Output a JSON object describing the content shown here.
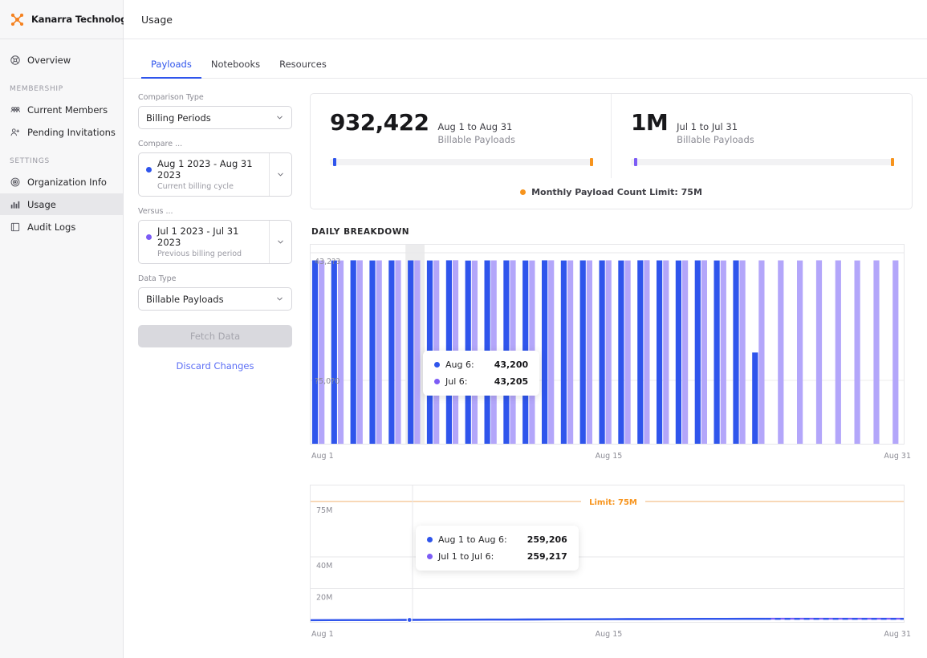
{
  "brand": {
    "name": "Kanarra Technologies",
    "logo_icon": "kanarra-node-logo-icon",
    "accent": "#F58220"
  },
  "sidebar": {
    "items": [
      {
        "label": "Overview",
        "icon": "overview-icon",
        "active": false
      }
    ],
    "groups": [
      {
        "title": "MEMBERSHIP",
        "items": [
          {
            "label": "Current Members",
            "icon": "users-icon",
            "active": false
          },
          {
            "label": "Pending Invitations",
            "icon": "user-plus-icon",
            "active": false
          }
        ]
      },
      {
        "title": "SETTINGS",
        "items": [
          {
            "label": "Organization Info",
            "icon": "gear-icon",
            "active": false
          },
          {
            "label": "Usage",
            "icon": "bar-chart-icon",
            "active": true
          },
          {
            "label": "Audit Logs",
            "icon": "book-icon",
            "active": false
          }
        ]
      }
    ]
  },
  "header": {
    "title": "Usage"
  },
  "tabs": [
    {
      "label": "Payloads",
      "active": true
    },
    {
      "label": "Notebooks",
      "active": false
    },
    {
      "label": "Resources",
      "active": false
    }
  ],
  "form": {
    "comparison_type": {
      "label": "Comparison Type",
      "value": "Billing Periods"
    },
    "compare": {
      "label": "Compare ...",
      "value": "Aug 1 2023 - Aug 31 2023",
      "sub": "Current billing cycle",
      "dot_color": "#2f55ec"
    },
    "versus": {
      "label": "Versus ...",
      "value": "Jul 1 2023 - Jul 31 2023",
      "sub": "Previous billing period",
      "dot_color": "#7c5cf5"
    },
    "data_type": {
      "label": "Data Type",
      "value": "Billable Payloads"
    },
    "fetch_button": "Fetch Data",
    "discard_button": "Discard Changes"
  },
  "summary": {
    "current": {
      "value": "932,422",
      "range": "Aug 1 to Aug 31",
      "type": "Billable Payloads",
      "marker_color": "#2f55ec",
      "marker_pct": 1.2,
      "limit_marker_pct": 99.3,
      "limit_color": "#F7941D"
    },
    "previous": {
      "value": "1M",
      "range": "Jul 1 to Jul 31",
      "type": "Billable Payloads",
      "marker_color": "#7c5cf5",
      "marker_pct": 1.2,
      "limit_marker_pct": 99.3,
      "limit_color": "#F7941D"
    },
    "legend": {
      "label": "Monthly Payload Count Limit: 75M",
      "color": "#F7941D"
    }
  },
  "daily_section_title": "DAILY BREAKDOWN",
  "daily_tooltip": {
    "rows": [
      {
        "label": "Aug 6:",
        "value": "43,200",
        "color": "#2f55ec"
      },
      {
        "label": "Jul 6:",
        "value": "43,205",
        "color": "#7c5cf5"
      }
    ]
  },
  "cumulative_tooltip": {
    "rows": [
      {
        "label": "Aug 1 to Aug 6:",
        "value": "259,206",
        "color": "#2f55ec"
      },
      {
        "label": "Jul 1 to Jul 6:",
        "value": "259,217",
        "color": "#7c5cf5"
      }
    ]
  },
  "limit_line": {
    "label": "Limit: 75M",
    "color": "#F7941D"
  },
  "chart_data": [
    {
      "type": "bar",
      "id": "daily-breakdown",
      "title": "DAILY BREAKDOWN",
      "xlabel": "",
      "ylabel": "",
      "grid": true,
      "legend_position": "none",
      "x_ticks": [
        "Aug 1",
        "Aug 15",
        "Aug 31"
      ],
      "y_ticks": [
        "43,2?3",
        "?5,0?0"
      ],
      "ylim": [
        0,
        45000
      ],
      "categories": [
        "1",
        "2",
        "3",
        "4",
        "5",
        "6",
        "7",
        "8",
        "9",
        "10",
        "11",
        "12",
        "13",
        "14",
        "15",
        "16",
        "17",
        "18",
        "19",
        "20",
        "21",
        "22",
        "23",
        "24",
        "25",
        "26",
        "27",
        "28",
        "29",
        "30",
        "31"
      ],
      "series": [
        {
          "name": "Aug 1 2023 - Aug 31 2023",
          "color": "#2f55ec",
          "values": [
            43200,
            43180,
            43220,
            43190,
            43210,
            43200,
            43190,
            43230,
            43170,
            43200,
            43210,
            43180,
            43220,
            43190,
            43200,
            43210,
            43180,
            43230,
            43200,
            43190,
            43210,
            43180,
            43200,
            21500,
            null,
            null,
            null,
            null,
            null,
            null,
            null
          ]
        },
        {
          "name": "Jul 1 2023 - Jul 31 2023",
          "color": "#b3a6fa",
          "values": [
            43205,
            43190,
            43225,
            43195,
            43215,
            43205,
            43195,
            43235,
            43175,
            43205,
            43215,
            43185,
            43225,
            43195,
            43205,
            43215,
            43185,
            43235,
            43205,
            43195,
            43215,
            43185,
            43205,
            43195,
            43210,
            43190,
            43220,
            43200,
            43180,
            43210,
            43200
          ]
        }
      ],
      "hover_index": 5
    },
    {
      "type": "line",
      "id": "cumulative-usage",
      "title": "",
      "xlabel": "",
      "ylabel": "",
      "grid": true,
      "legend_position": "none",
      "x_ticks": [
        "Aug 1",
        "Aug 15",
        "Aug 31"
      ],
      "y_ticks": [
        "75M",
        "40M",
        "20M"
      ],
      "ylim": [
        0,
        80000000
      ],
      "annotations": [
        {
          "text": "Limit: 75M",
          "y": 75000000,
          "color": "#F7941D"
        }
      ],
      "series": [
        {
          "name": "Aug 1 to Aug 31",
          "color": "#2f55ec",
          "style": "solid-then-dashed",
          "solid_until": 23,
          "values": [
            43200,
            86400,
            129600,
            172800,
            216000,
            259206,
            302400,
            345600,
            388800,
            432000,
            475200,
            518400,
            561600,
            604800,
            648000,
            691200,
            734400,
            777600,
            820800,
            864000,
            907200,
            928700,
            932422,
            932422,
            932422,
            932422,
            932422,
            932422,
            932422,
            932422,
            932422
          ]
        },
        {
          "name": "Jul 1 to Jul 31",
          "color": "#7c5cf5",
          "style": "solid",
          "values": [
            43205,
            86410,
            129615,
            172820,
            216025,
            259217,
            302430,
            345635,
            388840,
            432045,
            475250,
            518455,
            561660,
            604865,
            648070,
            691275,
            734480,
            777685,
            820890,
            864095,
            907300,
            950505,
            993710,
            1000000,
            1000000,
            1000000,
            1000000,
            1000000,
            1000000,
            1000000,
            1000000
          ]
        }
      ],
      "hover_index": 5
    }
  ]
}
